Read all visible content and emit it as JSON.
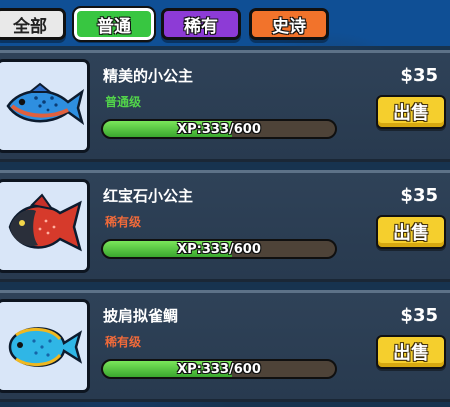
{
  "tabs": [
    {
      "label": "全部"
    },
    {
      "label": "普通"
    },
    {
      "label": "稀有"
    },
    {
      "label": "史诗"
    }
  ],
  "active_tab": "普通",
  "sell_label": "出售",
  "colors": {
    "common": "#52d34a",
    "rare": "#f06a3a",
    "sell_button": "#f5cf2d",
    "xp_fill": "#5cd04a"
  },
  "items": [
    {
      "name": "精美的小公主",
      "rarity": "普通级",
      "rarity_type": "common",
      "xp_text": "XP:333/600",
      "xp_current": 333,
      "xp_max": 600,
      "price": "$35",
      "icon": "blue-spotted-fish-icon"
    },
    {
      "name": "红宝石小公主",
      "rarity": "稀有级",
      "rarity_type": "rare",
      "xp_text": "XP:333/600",
      "xp_current": 333,
      "xp_max": 600,
      "price": "$35",
      "icon": "red-piranha-fish-icon"
    },
    {
      "name": "披肩拟雀鲷",
      "rarity": "稀有级",
      "rarity_type": "rare",
      "xp_text": "XP:333/600",
      "xp_current": 333,
      "xp_max": 600,
      "price": "$35",
      "icon": "blue-round-fish-icon"
    }
  ]
}
